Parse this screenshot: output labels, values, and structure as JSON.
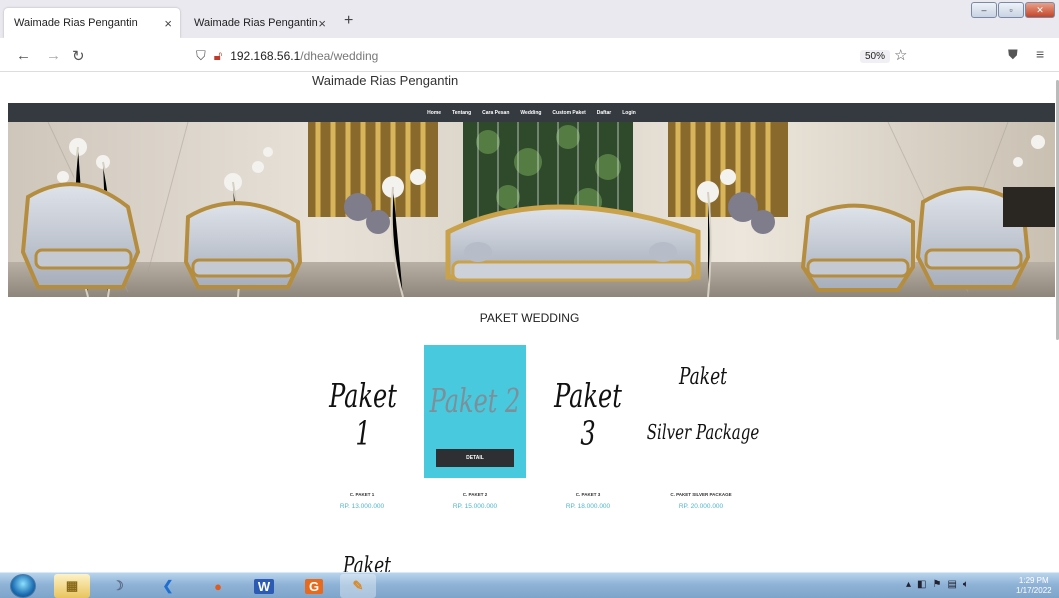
{
  "browser": {
    "tabs": [
      {
        "label": "Waimade Rias Pengantin",
        "close": "×"
      },
      {
        "label": "Waimade Rias Pengantin",
        "close": "×"
      }
    ],
    "new_tab": "+",
    "url_host": "192.168.56.1",
    "url_path": "/dhea/wedding",
    "zoom": "50%"
  },
  "site": {
    "title": "Waimade Rias Pengantin",
    "nav": [
      "Home",
      "Tentang",
      "Cara Pesan",
      "Wedding",
      "Custom Paket",
      "Daftar",
      "Login"
    ],
    "section_title": "PAKET WEDDING",
    "cards": [
      {
        "script_line1": "Paket 1",
        "script_line2": "",
        "name": "C. PAKET 1",
        "price": "RP. 13.000.000"
      },
      {
        "script_line1": "Paket 2",
        "script_line2": "",
        "name": "C. PAKET 2",
        "price": "RP. 15.000.000",
        "button": "DETAIL"
      },
      {
        "script_line1": "Paket 3",
        "script_line2": "",
        "name": "C. PAKET 3",
        "price": "RP. 18.000.000"
      },
      {
        "script_line1": "Paket",
        "script_line2": "Silver Package",
        "name": "C. PAKET SILVER PACKAGE",
        "price": "RP. 20.000.000"
      }
    ],
    "next_row_script": "Paket",
    "accent_color": "#48c9dd",
    "nav_bg_color": "#343a40"
  },
  "taskbar": {
    "apps": [
      "ie-icon",
      "explorer-icon",
      "app-icon",
      "vscode-icon",
      "firefox-icon",
      "word-icon",
      "office-icon",
      "paint-icon"
    ],
    "time": "1:29 PM",
    "date": "1/17/2022"
  }
}
